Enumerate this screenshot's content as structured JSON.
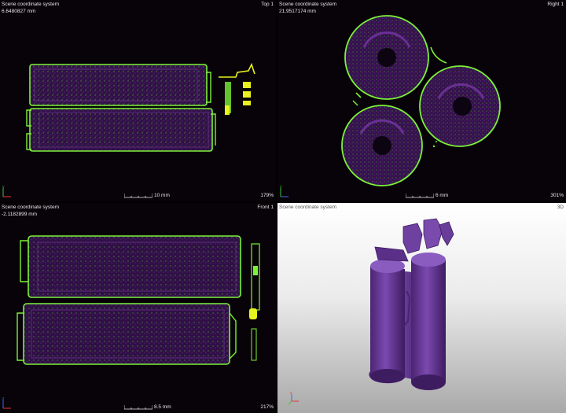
{
  "viewports": {
    "top": {
      "title": "Scene coordinate system",
      "coord": "6.6480827 mm",
      "name": "Top 1",
      "zoom": "179%",
      "scale": "10 mm"
    },
    "right": {
      "title": "Scene coordinate system",
      "coord": "21.9517174 mm",
      "name": "Right 1",
      "zoom": "301%",
      "scale": "6 mm"
    },
    "front": {
      "title": "Scene coordinate system",
      "coord": "-2.1182899 mm",
      "name": "Front 1",
      "zoom": "217%",
      "scale": "8.5 mm"
    },
    "view3d": {
      "title": "Scene coordinate system",
      "name": "3D"
    }
  },
  "axis_labels": {
    "x": "x",
    "y": "y",
    "z": "z"
  },
  "colors": {
    "outline": "#7CF23A",
    "volume": "#3A1458",
    "highlight": "#E8F21E",
    "model": "#6A3A9C",
    "axis_x": "#E23B3B",
    "axis_y": "#39C43A",
    "axis_z": "#3B6BE2"
  }
}
